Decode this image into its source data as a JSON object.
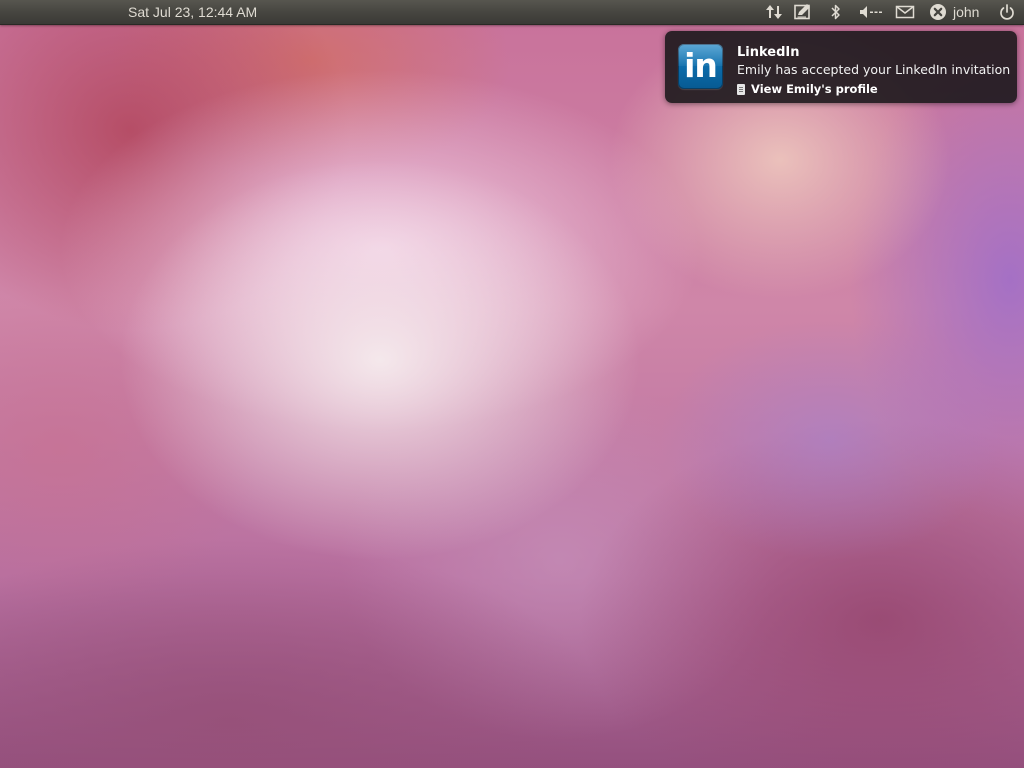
{
  "top_panel": {
    "clock": "Sat Jul 23, 12:44 AM",
    "indicators": {
      "network_icon": "network-updown-icon",
      "messages_icon": "messaging-compose-icon",
      "bluetooth_icon": "bluetooth-icon",
      "sound_icon": "sound-volume-icon",
      "mail_icon": "envelope-icon",
      "user_status_icon": "user-offline-x-icon",
      "power_icon": "power-icon"
    },
    "user_name": "john",
    "panel_color": "#45443f",
    "text_color": "#dfdbd2"
  },
  "notification": {
    "app_icon_text": "in",
    "app_icon_color": "#0b6aa8",
    "title": "LinkedIn",
    "body": "Emily has accepted your LinkedIn invitation",
    "action_label": "View Emily's profile",
    "action_icon": "document-icon"
  }
}
